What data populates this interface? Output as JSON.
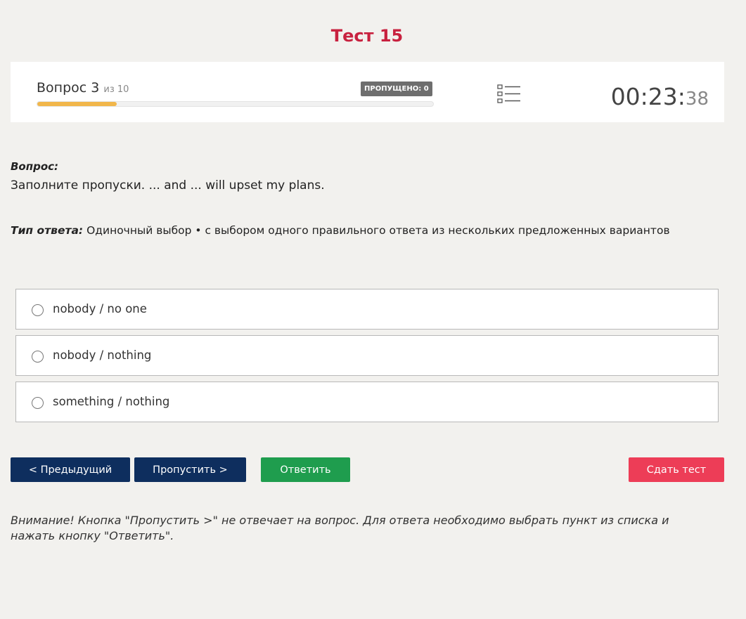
{
  "page": {
    "title": "Тест 15"
  },
  "header": {
    "question_label": "Вопрос 3",
    "question_total": "из 10",
    "skipped_badge": "ПРОПУЩЕНО: 0",
    "progress_fraction": 0.2,
    "timer_main": "00:23:",
    "timer_seconds": "38",
    "icons": {
      "question_list": "list-icon"
    }
  },
  "question": {
    "label": "Вопрос:",
    "text": "Заполните пропуски. ... and ... will upset my plans.",
    "answer_type_label": "Тип ответа:",
    "answer_type_text": "Одиночный выбор • с выбором одного правильного ответа из нескольких предложенных вариантов"
  },
  "options": [
    {
      "label": "nobody / no one",
      "selected": false
    },
    {
      "label": "nobody / nothing",
      "selected": false
    },
    {
      "label": "something / nothing",
      "selected": false
    }
  ],
  "buttons": {
    "prev": "< Предыдущий",
    "skip": "Пропустить >",
    "answer": "Ответить",
    "submit": "Сдать тест"
  },
  "colors": {
    "title": "#c8213f",
    "progress": "#f1b64a",
    "nav_button": "#0e2e5e",
    "answer_button": "#1f9d4e",
    "submit_button": "#ed3d57",
    "background": "#f2f1ee"
  },
  "notice": "Внимание! Кнопка \"Пропустить >\" не отвечает на вопрос. Для ответа необходимо выбрать пункт из списка и нажать кнопку \"Ответить\"."
}
